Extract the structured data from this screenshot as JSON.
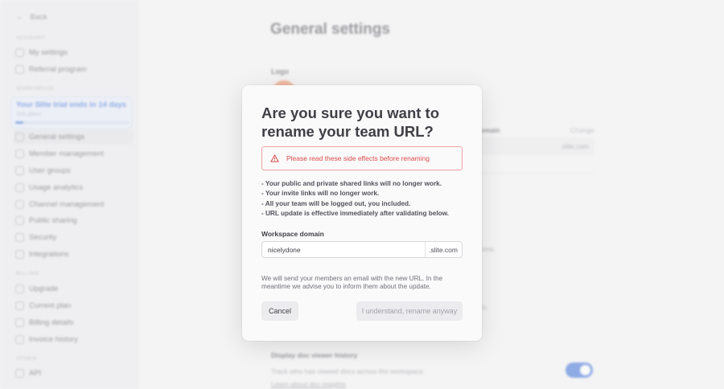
{
  "sidebar": {
    "back_label": "Back",
    "sections": {
      "account": "ACCOUNT",
      "workspace": "WORKSPACE",
      "billing": "BILLING",
      "other": "OTHER"
    },
    "account_items": [
      {
        "label": "My settings",
        "icon": "person-icon"
      },
      {
        "label": "Referral program",
        "icon": "gift-icon"
      }
    ],
    "trial": {
      "title": "Your Slite trial ends in 14 days",
      "subtitle": "See plans",
      "progress_percent": 7
    },
    "workspace_items": [
      {
        "label": "General settings",
        "icon": "gear-icon",
        "active": true
      },
      {
        "label": "Member management",
        "icon": "users-icon"
      },
      {
        "label": "User groups",
        "icon": "group-icon"
      },
      {
        "label": "Usage analytics",
        "icon": "chart-icon"
      },
      {
        "label": "Channel management",
        "icon": "channel-icon"
      },
      {
        "label": "Public sharing",
        "icon": "share-icon"
      },
      {
        "label": "Security",
        "icon": "lock-icon"
      },
      {
        "label": "Integrations",
        "icon": "puzzle-icon"
      }
    ],
    "billing_items": [
      {
        "label": "Upgrade",
        "icon": "upgrade-icon"
      },
      {
        "label": "Current plan",
        "icon": "plan-icon"
      },
      {
        "label": "Billing details",
        "icon": "receipt-icon"
      },
      {
        "label": "Invoice history",
        "icon": "invoice-icon"
      }
    ],
    "other_items": [
      {
        "label": "API",
        "icon": "code-icon"
      }
    ]
  },
  "main": {
    "title": "General settings",
    "logo_label": "Logo",
    "domain_label": "Domain",
    "domain_change": "Change",
    "domain_suffix": ".slite.com",
    "fragment_1": "time.",
    "fragment_2": "is.",
    "doc_viewer": {
      "title": "Display doc viewer history",
      "description": "Track who has viewed docs across the workspace.",
      "link": "Learn about doc insights",
      "enabled": true
    }
  },
  "modal": {
    "title": "Are you sure you want to rename your team URL?",
    "alert_text": "Please read these side effects before renaming",
    "effects": [
      "- Your public and private shared links will no longer work.",
      "- Your invite links will no longer work.",
      "- All your team will be logged out, you included.",
      "- URL update is effective immediately after validating below."
    ],
    "field_label": "Workspace domain",
    "field_value": "nicelydone",
    "field_suffix": ".slite.com",
    "note": "We will send your members an email with the new URL. In the meantime we advise you to inform them about the update.",
    "cancel_label": "Cancel",
    "confirm_label": "I understand, rename anyway"
  },
  "colors": {
    "accent": "#3b6fd8",
    "danger": "#dc4a4a",
    "logo": "#f08a5d"
  }
}
